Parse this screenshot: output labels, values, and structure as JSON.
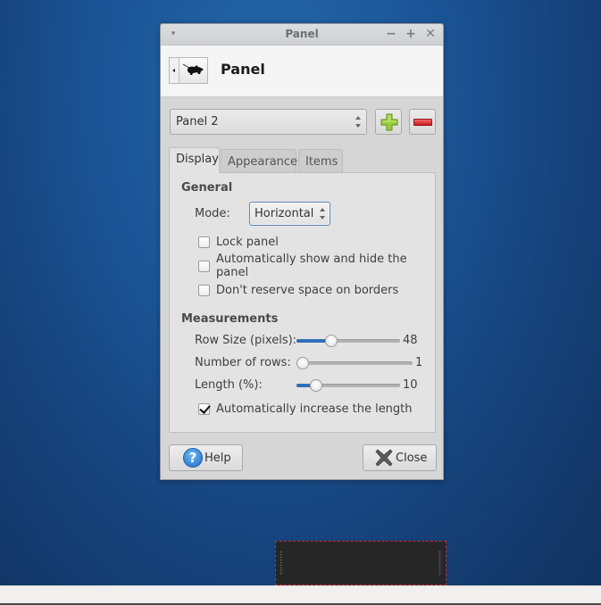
{
  "window": {
    "title": "Panel",
    "controls": {
      "menu": "▾",
      "minimize": "−",
      "maximize": "+",
      "close": "✕"
    }
  },
  "header": {
    "icon": "xfce-panel-mouse-icon",
    "title": "Panel"
  },
  "panel_selector": {
    "selected": "Panel 2",
    "add_icon": "plus-icon",
    "remove_icon": "minus-icon",
    "add_color": "#8cc63f",
    "remove_color": "#d9282c"
  },
  "tabs": [
    {
      "label": "Display",
      "active": true
    },
    {
      "label": "Appearance",
      "active": false
    },
    {
      "label": "Items",
      "active": false
    }
  ],
  "display": {
    "general": {
      "title": "General",
      "mode_label": "Mode:",
      "mode_value": "Horizontal",
      "checkboxes": [
        {
          "label": "Lock panel",
          "checked": false
        },
        {
          "label": "Automatically show and hide the panel",
          "checked": false
        },
        {
          "label": "Don't reserve space on borders",
          "checked": false
        }
      ]
    },
    "measurements": {
      "title": "Measurements",
      "sliders": [
        {
          "label": "Row Size (pixels):",
          "value": "48",
          "fraction": 0.31
        },
        {
          "label": "Number of rows:",
          "value": "1",
          "fraction": 0.0
        },
        {
          "label": "Length (%):",
          "value": "10",
          "fraction": 0.15
        }
      ],
      "auto_length": {
        "label": "Automatically increase the length",
        "checked": true
      }
    }
  },
  "buttons": {
    "help": "Help",
    "close": "Close"
  },
  "colors": {
    "slider_fill": "#2f6fb8",
    "panel_preview_border": "#c4283c",
    "desktop": "#1b5597"
  }
}
